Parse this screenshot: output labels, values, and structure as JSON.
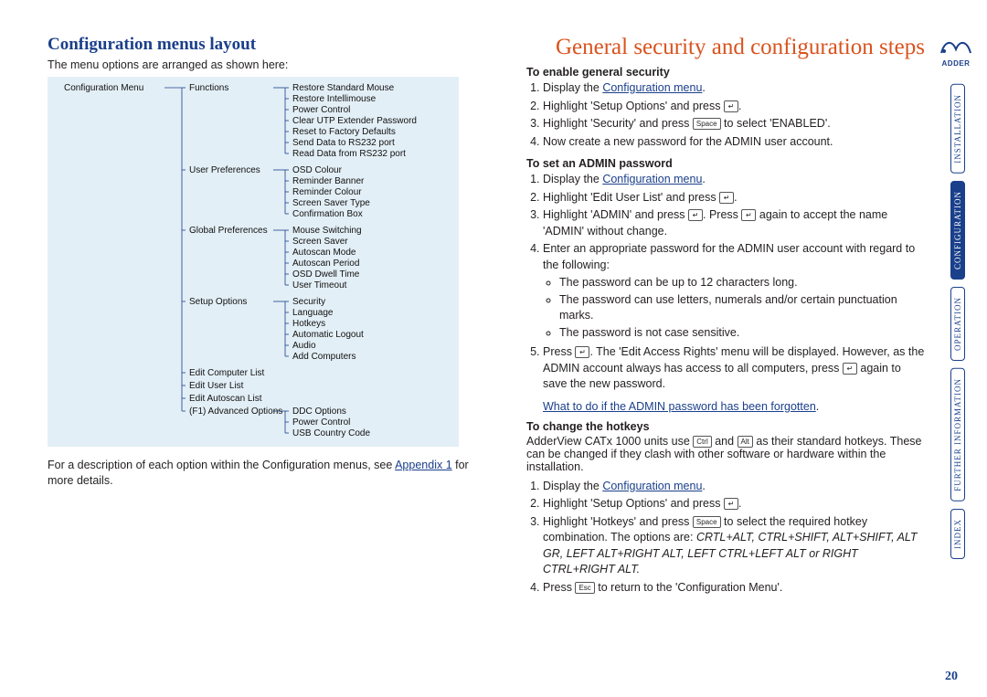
{
  "left": {
    "title": "Configuration menus layout",
    "intro": "The menu options are arranged as shown here:",
    "footer_a": "For a description of each option within the Configuration menus, see ",
    "footer_link": "Appendix 1",
    "footer_b": " for more details."
  },
  "diagram": {
    "root": "Configuration Menu",
    "groups": [
      {
        "name": "Functions",
        "items": [
          "Restore Standard Mouse",
          "Restore Intellimouse",
          "Power Control",
          "Clear UTP Extender Password",
          "Reset to Factory Defaults",
          "Send Data to RS232 port",
          "Read Data from RS232 port"
        ]
      },
      {
        "name": "User Preferences",
        "items": [
          "OSD Colour",
          "Reminder Banner",
          "Reminder Colour",
          "Screen Saver Type",
          "Confirmation Box"
        ]
      },
      {
        "name": "Global Preferences",
        "items": [
          "Mouse Switching",
          "Screen Saver",
          "Autoscan Mode",
          "Autoscan Period",
          "OSD Dwell Time",
          "User Timeout"
        ]
      },
      {
        "name": "Setup Options",
        "items": [
          "Security",
          "Language",
          "Hotkeys",
          "Automatic Logout",
          "Audio",
          "Add Computers"
        ]
      },
      {
        "name": "Edit Computer List",
        "items": []
      },
      {
        "name": "Edit User List",
        "items": []
      },
      {
        "name": "Edit Autoscan List",
        "items": []
      },
      {
        "name": "(F1) Advanced Options",
        "items": [
          "DDC Options",
          "Power Control",
          "USB Country Code"
        ]
      }
    ]
  },
  "right": {
    "title": "General security and configuration steps",
    "sec1_head": "To enable general security",
    "sec1": {
      "s1a": "Display the ",
      "s1link": "Configuration menu",
      "s1b": ".",
      "s2a": "Highlight 'Setup Options' and press ",
      "s2b": ".",
      "s3a": "Highlight 'Security' and press ",
      "s3b": " to select 'ENABLED'.",
      "s4": "Now create a new password for the ADMIN user account."
    },
    "sec2_head": "To set an ADMIN password",
    "sec2": {
      "s1a": "Display the ",
      "s1link": "Configuration menu",
      "s1b": ".",
      "s2a": "Highlight 'Edit User List' and press ",
      "s2b": ".",
      "s3a": "Highlight 'ADMIN' and press ",
      "s3b": ". Press ",
      "s3c": " again to accept the name 'ADMIN' without change.",
      "s4": "Enter an appropriate password for the ADMIN user account with regard to the following:",
      "b1": "The password can be up to 12 characters long.",
      "b2": "The password can use letters, numerals and/or certain punctuation marks.",
      "b3": "The password is not case sensitive.",
      "s5a": "Press ",
      "s5b": ". The 'Edit Access Rights' menu will be displayed. However, as the ADMIN account always has access to all computers, press ",
      "s5c": " again to save the new password."
    },
    "forgot_link": "What to do if the ADMIN password has been forgotten",
    "forgot_dot": ".",
    "sec3_head": "To change the hotkeys",
    "sec3": {
      "intro_a": "AdderView CATx 1000 units use ",
      "intro_b": " and ",
      "intro_c": " as their standard hotkeys. These can be changed if they clash with other software or hardware within the installation.",
      "s1a": "Display the ",
      "s1link": "Configuration menu",
      "s1b": ".",
      "s2a": "Highlight 'Setup Options' and press ",
      "s2b": ".",
      "s3a": "Highlight 'Hotkeys' and press ",
      "s3b": " to select the required hotkey combination. The options are: ",
      "s3opts": "CRTL+ALT, CTRL+SHIFT, ALT+SHIFT, ALT GR, LEFT ALT+RIGHT ALT, LEFT CTRL+LEFT ALT or RIGHT CTRL+RIGHT ALT.",
      "s4a": "Press ",
      "s4b": " to return to the 'Configuration Menu'."
    }
  },
  "keys": {
    "enter": "↵",
    "space": "Space",
    "ctrl": "Ctrl",
    "alt": "Alt",
    "esc": "Esc"
  },
  "nav": {
    "tabs": [
      "INSTALLATION",
      "CONFIGURATION",
      "OPERATION",
      "FURTHER INFORMATION",
      "INDEX"
    ],
    "active_index": 1
  },
  "logo_text": "ADDER",
  "page_number": "20"
}
